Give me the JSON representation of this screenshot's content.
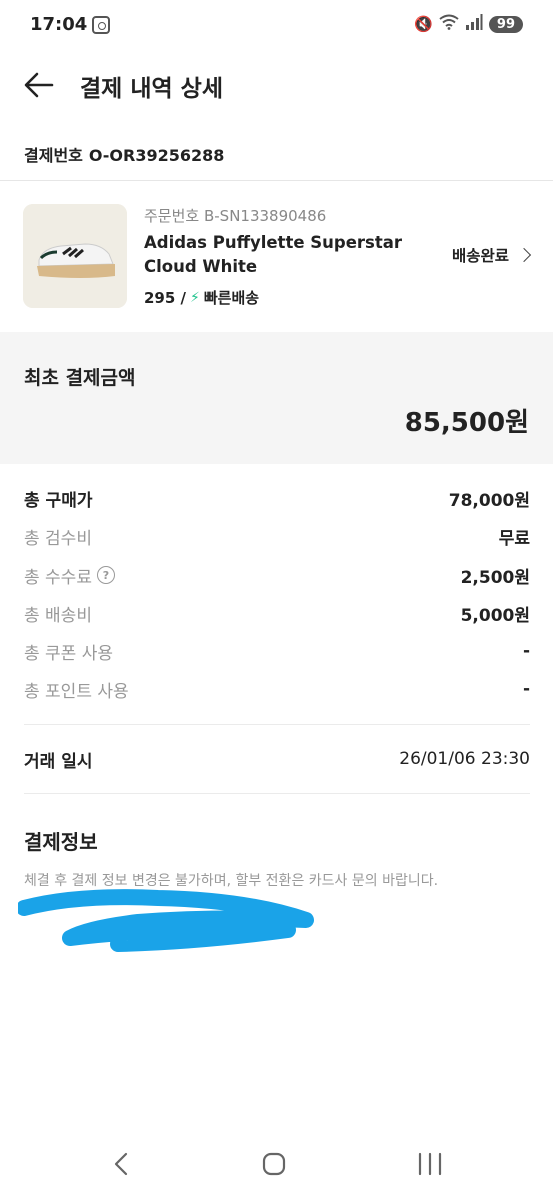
{
  "status_bar": {
    "time": "17:04",
    "battery": "99",
    "icons": [
      "screenshot-icon",
      "mute-icon",
      "wifi-icon",
      "signal-icon"
    ]
  },
  "header": {
    "title": "결제 내역 상세",
    "back_icon": "back-arrow-icon"
  },
  "payment": {
    "number_label": "결제번호",
    "number": "O-OR39256288"
  },
  "product": {
    "order_number": "주문번호 B-SN133890486",
    "name": "Adidas Puffylette Superstar Cloud White",
    "size": "295 /",
    "shipping_badge": "빠른배송",
    "status": "배송완료"
  },
  "initial_payment": {
    "label": "최초 결제금액",
    "amount": "85,500원"
  },
  "breakdown": [
    {
      "label": "총 구매가",
      "value": "78,000원"
    },
    {
      "label": "총 검수비",
      "value": "무료"
    },
    {
      "label": "총 수수료",
      "value": "2,500원"
    },
    {
      "label": "총 배송비",
      "value": "5,000원"
    },
    {
      "label": "총 쿠폰 사용",
      "value": "-"
    },
    {
      "label": "총 포인트 사용",
      "value": "-"
    }
  ],
  "transaction": {
    "label": "거래 일시",
    "value": "26/01/06 23:30"
  },
  "payment_info": {
    "title": "결제정보",
    "notice": "체결 후 결제 정보 변경은 불가하며, 할부 전환은 카드사 문의 바랍니다."
  },
  "colors": {
    "accent_green": "#22c38e",
    "scribble_blue": "#1aa3e8",
    "muted_text": "#999999",
    "panel_bg": "#f5f5f5"
  }
}
